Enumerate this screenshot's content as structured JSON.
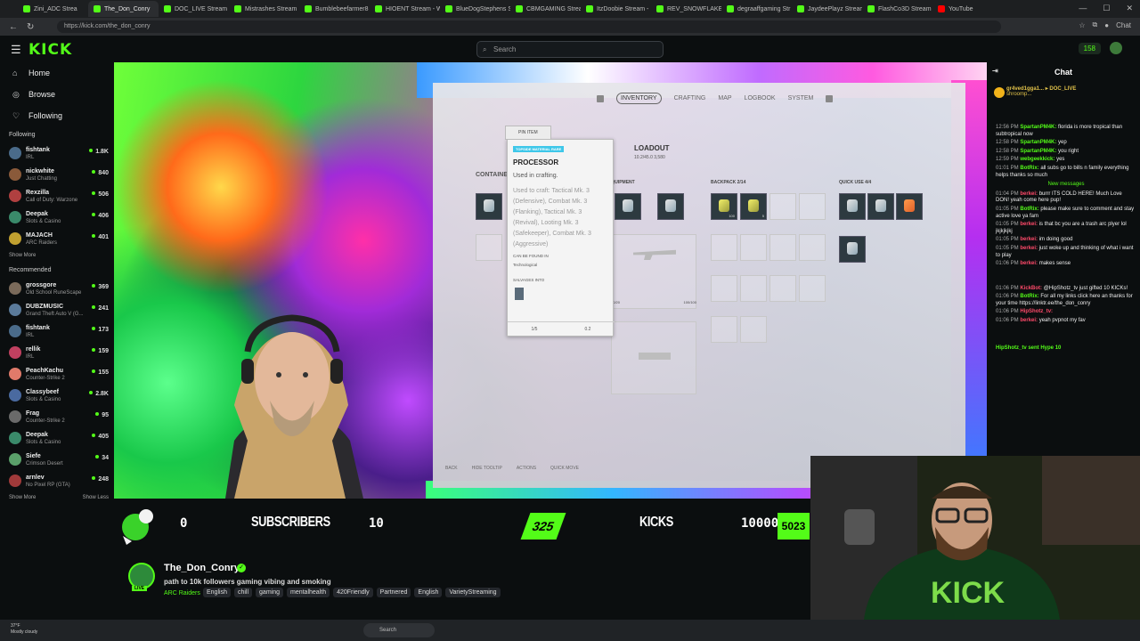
{
  "browser": {
    "tabs": [
      {
        "label": "Zini_ADC Strea",
        "active": false
      },
      {
        "label": "The_Don_Conry",
        "active": true
      },
      {
        "label": "DOC_LIVE Stream",
        "active": false
      },
      {
        "label": "Mistrashes Stream",
        "active": false
      },
      {
        "label": "Bumblebeefarmer8",
        "active": false
      },
      {
        "label": "HIOENT Stream - W",
        "active": false
      },
      {
        "label": "BlueDogStephens S",
        "active": false
      },
      {
        "label": "CBMGAMING Strea",
        "active": false
      },
      {
        "label": "ItzDoobie Stream -",
        "active": false
      },
      {
        "label": "REV_SNOWFLAKE_K",
        "active": false
      },
      {
        "label": "degraaffgaming Str",
        "active": false
      },
      {
        "label": "JaydeePlayz Stream",
        "active": false
      },
      {
        "label": "FlashCo3D Stream",
        "active": false
      },
      {
        "label": "YouTube",
        "active": false
      }
    ],
    "url": "https://kick.com/the_don_conry",
    "chat_label": "Chat"
  },
  "header": {
    "logo": "KICK",
    "search_placeholder": "Search",
    "points": "158"
  },
  "sidebar": {
    "nav": [
      {
        "label": "Home",
        "icon": "home-icon"
      },
      {
        "label": "Browse",
        "icon": "compass-icon"
      },
      {
        "label": "Following",
        "icon": "heart-icon"
      }
    ],
    "following_title": "Following",
    "following": [
      {
        "name": "fishtank",
        "game": "IRL",
        "viewers": "1.8K",
        "color": "#4a6b8a"
      },
      {
        "name": "nickwhite",
        "game": "Just Chatting",
        "viewers": "840",
        "color": "#8a5a3a"
      },
      {
        "name": "Rexzilla",
        "game": "Call of Duty: Warzone",
        "viewers": "506",
        "color": "#b04040"
      },
      {
        "name": "Deepak",
        "game": "Slots & Casino",
        "viewers": "406",
        "color": "#3a8a6a"
      },
      {
        "name": "MAJACH",
        "game": "ARC Raiders",
        "viewers": "401",
        "color": "#c0a030"
      }
    ],
    "show_more": "Show More",
    "recommended_title": "Recommended",
    "recommended": [
      {
        "name": "grossgore",
        "game": "Old School RuneScape",
        "viewers": "369",
        "color": "#7a6a5a"
      },
      {
        "name": "DUBZMUSIC",
        "game": "Grand Theft Auto V (G...",
        "viewers": "241",
        "color": "#5a7a9a"
      },
      {
        "name": "fishtank",
        "game": "IRL",
        "viewers": "173",
        "color": "#4a6b8a"
      },
      {
        "name": "rellik",
        "game": "IRL",
        "viewers": "159",
        "color": "#c04060"
      },
      {
        "name": "PeachKachu",
        "game": "Counter-Strike 2",
        "viewers": "155",
        "color": "#e07a6a"
      },
      {
        "name": "Classybeef",
        "game": "Slots & Casino",
        "viewers": "2.8K",
        "color": "#4a6aa0"
      },
      {
        "name": "Frag",
        "game": "Counter-Strike 2",
        "viewers": "95",
        "color": "#6a6a6a"
      },
      {
        "name": "Deepak",
        "game": "Slots & Casino",
        "viewers": "405",
        "color": "#3a8a6a"
      },
      {
        "name": "Siefe",
        "game": "Crimson Desert",
        "viewers": "34",
        "color": "#5aa06a"
      },
      {
        "name": "arnlev",
        "game": "No Pixel RP (GTA)",
        "viewers": "248",
        "color": "#a03a3a"
      }
    ],
    "show_less": "Show Less"
  },
  "game": {
    "tabs": [
      "INVENTORY",
      "CRAFTING",
      "MAP",
      "LOGBOOK",
      "SYSTEM"
    ],
    "active_tab": "INVENTORY",
    "loadout": "LOADOUT",
    "loadout_sub": "10.2/45.0   3,580",
    "containers": "CONTAINERS",
    "equipment": "EQUIPMENT",
    "backpack": "BACKPACK  2/14",
    "quick_use": "QUICK USE  4/4",
    "weapon_stats_left": "20/20",
    "weapon_stats_right": "100/100",
    "tooltip": {
      "pin": "PIN ITEM",
      "badge": "TOPSIDE MATERIAL  RARE",
      "title": "PROCESSOR",
      "used": "Used in crafting.",
      "craft": "Used to craft: Tactical Mk. 3 (Defensive), Combat Mk. 3 (Flanking), Tactical Mk. 3 (Revival), Looting Mk. 3 (Safekeeper), Combat Mk. 3 (Aggressive)",
      "found_label": "CAN BE FOUND IN",
      "found_value": "Technological",
      "salvages": "SALVAGES INTO",
      "foot_qty": "1/5",
      "foot_weight": "0.2"
    },
    "footer": [
      "BACK",
      "HIDE TOOLTIP",
      "ACTIONS",
      "QUICK MOVE"
    ]
  },
  "overlay": {
    "subs": "0",
    "subs_label": "SUBSCRIBERS",
    "subs_goal": "10",
    "kicks_progress": "325",
    "kicks_label": "KICKS",
    "kicks_goal": "10000",
    "kicks_current": "5023"
  },
  "channel": {
    "name": "The_Don_Conry",
    "title": "path to 10k followers gaming vibing and smoking",
    "game": "ARC Raiders",
    "live": "LIVE",
    "tags": [
      "English",
      "chill",
      "gaming",
      "mentalhealth",
      "420Friendly",
      "Partnered",
      "English",
      "VarietyStreaming"
    ]
  },
  "chat": {
    "title": "Chat",
    "pinned_user": "gr4ved1gga1...",
    "pinned_target": "DOC_LIVE",
    "pinned_text": "shroomp...",
    "new_messages": "New messages",
    "messages": [
      {
        "time": "12:56 PM",
        "user": "SpartanPM4K:",
        "color": "#53fc18",
        "text": "florida is more tropical than subtropical now"
      },
      {
        "time": "12:58 PM",
        "user": "SpartanPM4K:",
        "color": "#53fc18",
        "text": "yep"
      },
      {
        "time": "12:58 PM",
        "user": "SpartanPM4K:",
        "color": "#53fc18",
        "text": "you right"
      },
      {
        "time": "12:59 PM",
        "user": "webgeekkick:",
        "color": "#53fc18",
        "text": "yes"
      },
      {
        "time": "01:01 PM",
        "user": "BotRix:",
        "color": "#53fc18",
        "text": "all subs go to bills n family everything helps thanks so much"
      },
      {
        "time": "01:04 PM",
        "user": "berkei:",
        "color": "#ff4a6a",
        "text": "burrr ITS COLD HERE! Much Love DON! yeah come here pup!"
      },
      {
        "time": "01:05 PM",
        "user": "BotRix:",
        "color": "#53fc18",
        "text": "please make sure to comment and stay active love ya fam"
      },
      {
        "time": "01:05 PM",
        "user": "berkei:",
        "color": "#ff4a6a",
        "text": "is that bc you are a trash arc plyer lol jkjkjkjkj"
      },
      {
        "time": "01:05 PM",
        "user": "berkei:",
        "color": "#ff4a6a",
        "text": "im doing good"
      },
      {
        "time": "01:05 PM",
        "user": "berkei:",
        "color": "#ff4a6a",
        "text": "just woke up and thinking of what i want to play"
      },
      {
        "time": "01:06 PM",
        "user": "berkei:",
        "color": "#ff4a6a",
        "text": "makes sense"
      },
      {
        "time": "01:06 PM",
        "user": "KickBot:",
        "color": "#ff4a6a",
        "text": "@HipShotz_tv just gifted 10 KICKs!"
      },
      {
        "time": "01:06 PM",
        "user": "BotRix:",
        "color": "#53fc18",
        "text": "For all my links click here an thanks for your time https://linktr.ee/the_don_conry"
      },
      {
        "time": "01:06 PM",
        "user": "HipShotz_tv:",
        "color": "#ff4a6a",
        "text": ""
      },
      {
        "time": "01:06 PM",
        "user": "berkei:",
        "color": "#ff4a6a",
        "text": "yeah pvpnot my fav"
      }
    ],
    "hype_user": "HipShotz_tv",
    "hype_text": "sent Hype",
    "hype_count": "10"
  },
  "taskbar": {
    "temp": "37°F",
    "weather": "Mostly cloudy",
    "search": "Search"
  }
}
